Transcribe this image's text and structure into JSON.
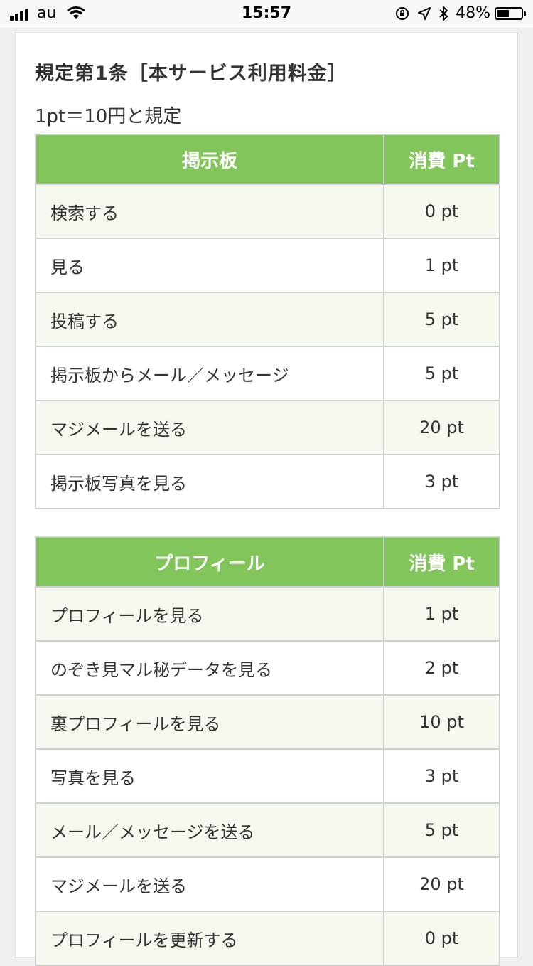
{
  "status_bar": {
    "carrier": "au",
    "time": "15:57",
    "battery_percent": "48%",
    "icons": [
      "signal-icon",
      "wifi-icon",
      "orientation-lock-icon",
      "location-icon",
      "bluetooth-icon",
      "battery-icon"
    ]
  },
  "rule": {
    "title": "規定第1条［本サービス利用料金］",
    "subtitle": "1pt＝10円と規定"
  },
  "tables": [
    {
      "header": "掲示板",
      "cost_header": "消費 Pt",
      "rows": [
        {
          "label": "検索する",
          "cost": "0 pt"
        },
        {
          "label": "見る",
          "cost": "1 pt"
        },
        {
          "label": "投稿する",
          "cost": "5 pt"
        },
        {
          "label": "掲示板からメール／メッセージ",
          "cost": "5 pt"
        },
        {
          "label": "マジメールを送る",
          "cost": "20 pt"
        },
        {
          "label": "掲示板写真を見る",
          "cost": "3 pt"
        }
      ]
    },
    {
      "header": "プロフィール",
      "cost_header": "消費 Pt",
      "rows": [
        {
          "label": "プロフィールを見る",
          "cost": "1 pt"
        },
        {
          "label": "のぞき見マル秘データを見る",
          "cost": "2 pt"
        },
        {
          "label": "裏プロフィールを見る",
          "cost": "10 pt"
        },
        {
          "label": "写真を見る",
          "cost": "3 pt"
        },
        {
          "label": "メール／メッセージを送る",
          "cost": "5 pt"
        },
        {
          "label": "マジメールを送る",
          "cost": "20 pt"
        },
        {
          "label": "プロフィールを更新する",
          "cost": "0 pt"
        }
      ]
    }
  ],
  "colors": {
    "header_green": "#82c55a",
    "row_tint": "#f4f9ef",
    "border": "#cfcfcf"
  }
}
